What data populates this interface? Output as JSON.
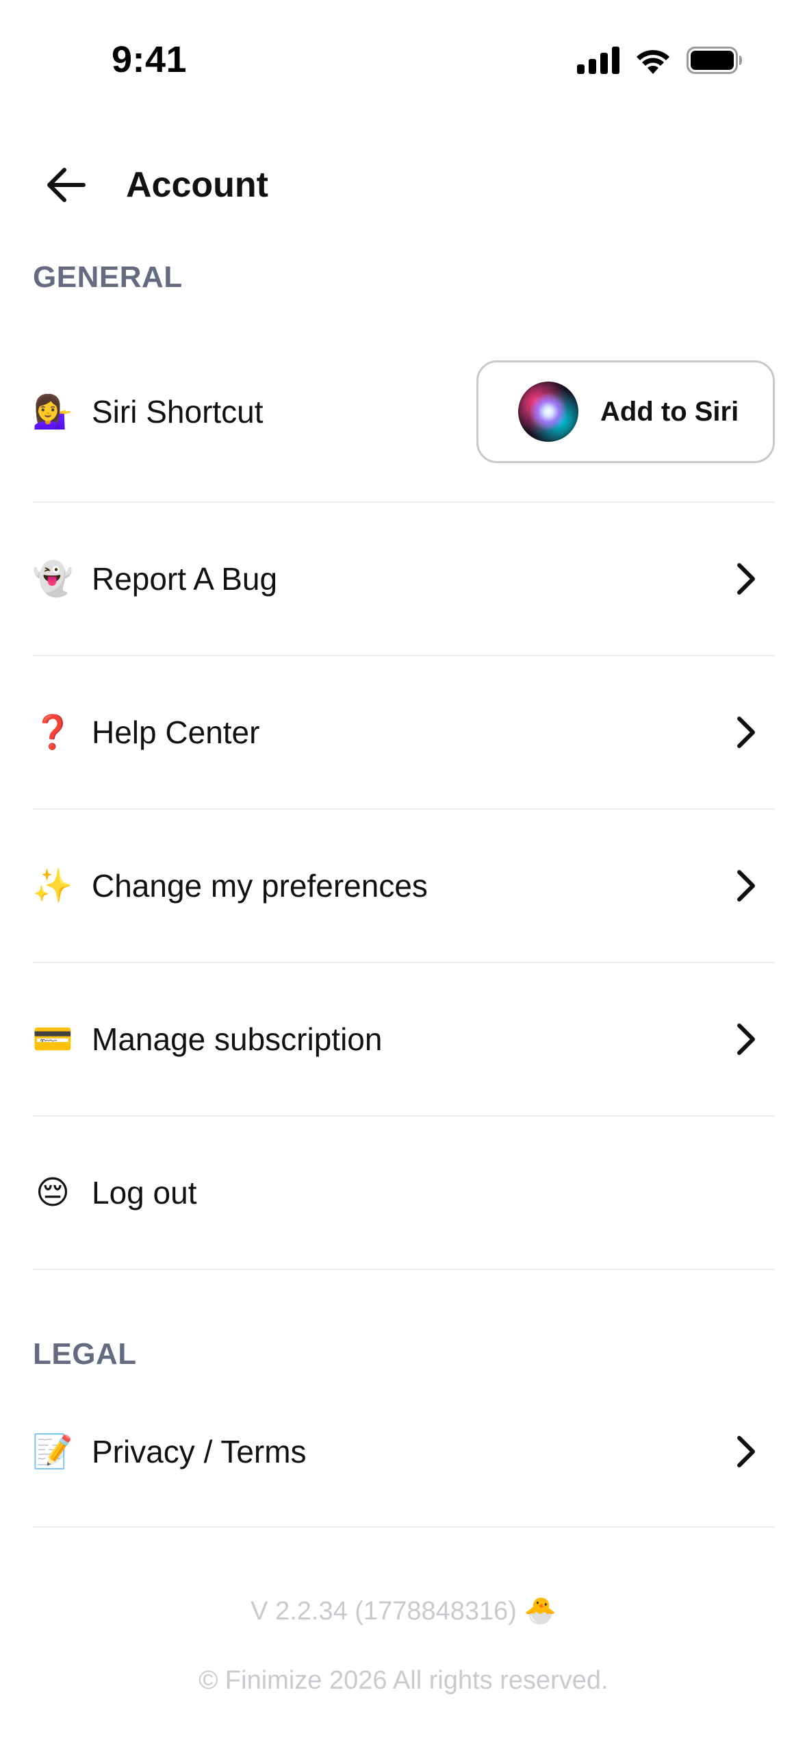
{
  "status_bar": {
    "time": "9:41",
    "icons": [
      "signal-icon",
      "wifi-icon",
      "battery-icon"
    ]
  },
  "header": {
    "back_icon": "arrow-left-icon",
    "title": "Account"
  },
  "sections": {
    "general": "GENERAL",
    "legal": "LEGAL"
  },
  "rows": {
    "siri": {
      "emoji": "💁‍♀️",
      "label": "Siri Shortcut",
      "button_label": "Add to Siri"
    },
    "bug": {
      "emoji": "👻",
      "label": "Report A Bug"
    },
    "help": {
      "emoji": "❓",
      "label": "Help Center"
    },
    "preferences": {
      "emoji": "✨",
      "label": "Change my preferences"
    },
    "subscription": {
      "emoji": "💳",
      "label": "Manage subscription"
    },
    "logout": {
      "emoji": "😔",
      "label": "Log out"
    },
    "privacy": {
      "emoji": "📝",
      "label": "Privacy / Terms"
    }
  },
  "footer": {
    "version": "V 2.2.34 (1778848316) 🐣",
    "copyright": "© Finimize 2026 All rights reserved."
  },
  "colors": {
    "section_header": "#646b80",
    "divider": "#ebebef",
    "footer_text": "#c9c9cf"
  }
}
